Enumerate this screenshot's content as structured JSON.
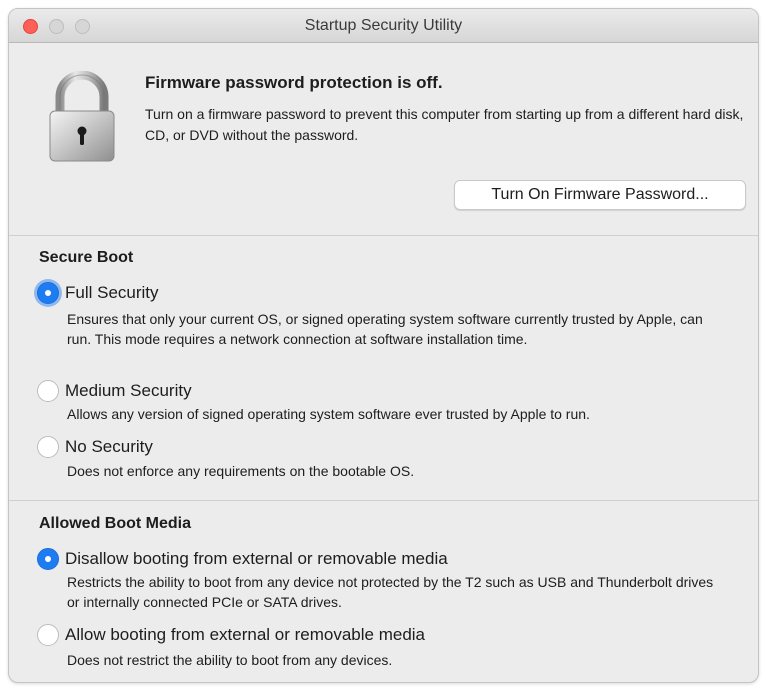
{
  "window": {
    "title": "Startup Security Utility"
  },
  "firmware": {
    "heading": "Firmware password protection is off.",
    "description": "Turn on a firmware password to prevent this computer from starting up from a different hard disk, CD, or DVD without the password.",
    "button_label": "Turn On Firmware Password..."
  },
  "secure_boot": {
    "heading": "Secure Boot",
    "selected": "Full Security",
    "options": [
      {
        "label": "Full Security",
        "description": "Ensures that only your current OS, or signed operating system software currently trusted by Apple, can run. This mode requires a network connection at software installation time.",
        "selected": true
      },
      {
        "label": "Medium Security",
        "description": "Allows any version of signed operating system software ever trusted by Apple to run.",
        "selected": false
      },
      {
        "label": "No Security",
        "description": "Does not enforce any requirements on the bootable OS.",
        "selected": false
      }
    ]
  },
  "boot_media": {
    "heading": "Allowed Boot Media",
    "selected": "Disallow booting from external or removable media",
    "options": [
      {
        "label": "Disallow booting from external or removable media",
        "description": "Restricts the ability to boot from any device not protected by the T2 such as USB and Thunderbolt drives or internally connected PCIe or SATA drives.",
        "selected": true
      },
      {
        "label": "Allow booting from external or removable media",
        "description": "Does not restrict the ability to boot from any devices.",
        "selected": false
      }
    ]
  },
  "colors": {
    "accent": "#1e7cf2",
    "close_button": "#fe5f57",
    "window_bg": "#ececec"
  },
  "icons": {
    "lock": "padlock-icon"
  }
}
